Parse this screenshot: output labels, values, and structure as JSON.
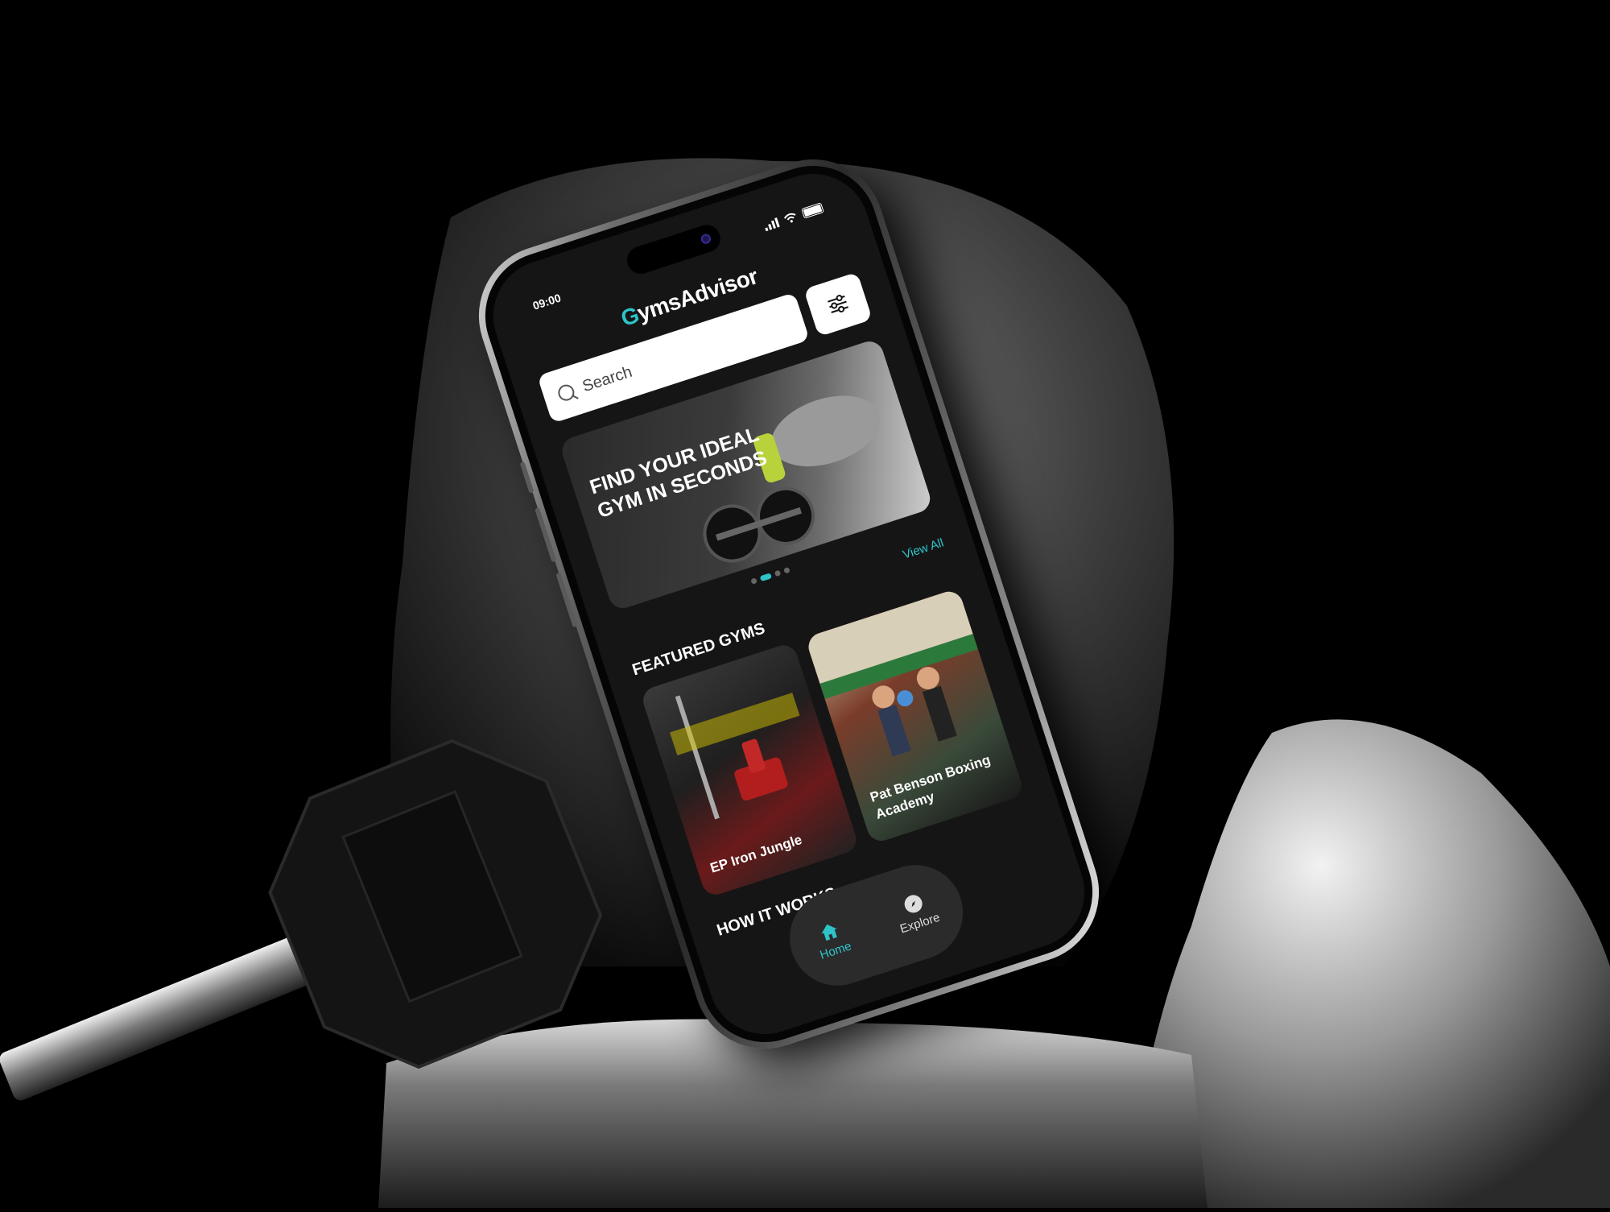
{
  "status": {
    "time": "09:00"
  },
  "app": {
    "logo_g": "G",
    "logo_rest": "ymsAdvisor"
  },
  "search": {
    "placeholder": "Search"
  },
  "banner": {
    "text": "FIND YOUR IDEAL GYM IN SECONDS",
    "slides": 4,
    "active_slide": 2
  },
  "featured": {
    "title": "FEATURED GYMS",
    "view_all": "View All",
    "gyms": [
      {
        "name": "EP Iron Jungle"
      },
      {
        "name": "Pat Benson Boxing Academy"
      }
    ]
  },
  "how_it_works": {
    "title": "HOW IT WORKS"
  },
  "tabbar": {
    "items": [
      {
        "label": "Home",
        "icon": "home-icon",
        "active": true
      },
      {
        "label": "Explore",
        "icon": "compass-icon",
        "active": false
      }
    ]
  },
  "colors": {
    "accent": "#2ec4c9",
    "background": "#151515"
  }
}
